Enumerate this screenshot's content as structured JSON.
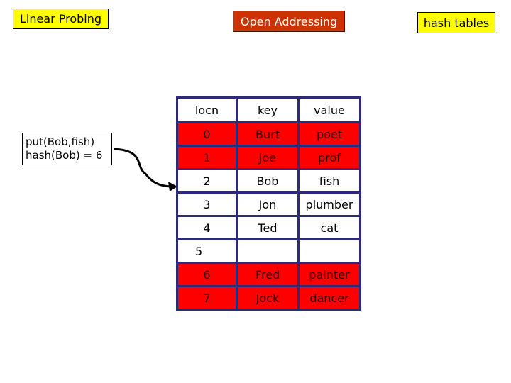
{
  "titles": {
    "left": "Linear Probing",
    "center": "Open Addressing",
    "right": "hash tables"
  },
  "colors": {
    "title_yellow": "#ffff00",
    "title_center_bg": "#cc3300",
    "title_center_text": "#ffffff",
    "occupied_cell": "#ff0000",
    "empty_cell": "#ffffff",
    "grid": "#2e2a7a"
  },
  "operation": {
    "line1": "put(Bob,fish)",
    "line2": "hash(Bob) = 6"
  },
  "table": {
    "headers": [
      "locn",
      "key",
      "value"
    ],
    "rows": [
      {
        "locn": "0",
        "key": "Burt",
        "value": "poet",
        "occupied": true
      },
      {
        "locn": "1",
        "key": "Joe",
        "value": "prof",
        "occupied": true
      },
      {
        "locn": "2",
        "key": "Bob",
        "value": "fish",
        "occupied": false
      },
      {
        "locn": "3",
        "key": "Jon",
        "value": "plumber",
        "occupied": false
      },
      {
        "locn": "4",
        "key": "Ted",
        "value": "cat",
        "occupied": false
      },
      {
        "locn": "5",
        "key": "",
        "value": "",
        "occupied": false
      },
      {
        "locn": "6",
        "key": "Fred",
        "value": "painter",
        "occupied": true
      },
      {
        "locn": "7",
        "key": "Jock",
        "value": "dancer",
        "occupied": true
      }
    ]
  },
  "arrow": {
    "from": "operation-box",
    "to_row_locn": "2",
    "icon": "curved-arrow-icon"
  }
}
